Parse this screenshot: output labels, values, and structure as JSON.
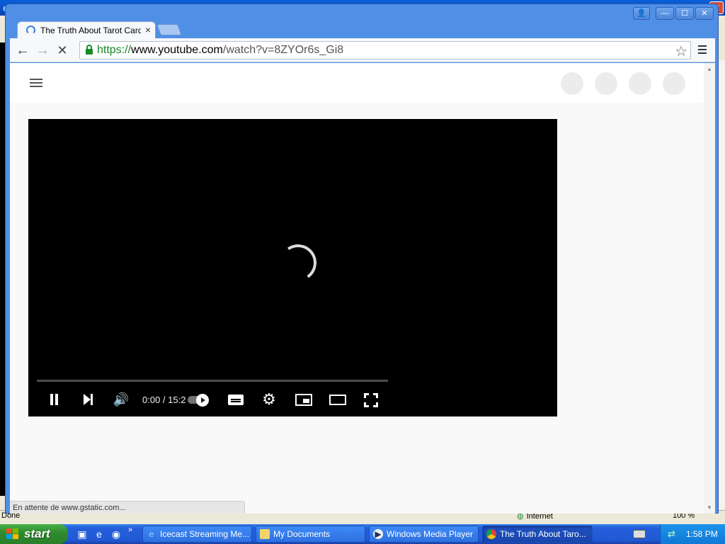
{
  "background_window": {
    "status_left": "Done",
    "status_zone": "Internet",
    "status_zoom": "100 %",
    "close_glyph": "✕"
  },
  "chrome": {
    "caption_user": "👤",
    "caption_min": "—",
    "caption_max": "☐",
    "caption_close": "✕",
    "tab": {
      "title": "The Truth About Tarot Cards",
      "close": "×"
    },
    "nav": {
      "back": "←",
      "forward": "→",
      "stop": "✕"
    },
    "address": {
      "scheme": "https://",
      "host": "www.youtube.com",
      "path": "/watch?v=8ZYOr6s_Gi8"
    },
    "bookmark_star": "☆"
  },
  "page": {
    "player": {
      "time": "0:00 / 15:2",
      "volume_glyph": "🔊",
      "settings_glyph": "⚙"
    },
    "status_bubble": "En attente de www.gstatic.com..."
  },
  "taskbar": {
    "start_label": "start",
    "more": "»",
    "tasks": [
      {
        "label": "Icecast Streaming Me...",
        "icon": "ie-icon"
      },
      {
        "label": "My Documents",
        "icon": "folder-icon"
      },
      {
        "label": "Windows Media Player",
        "icon": "media-player-icon"
      },
      {
        "label": "The Truth About Taro...",
        "icon": "chrome-icon"
      }
    ],
    "clock": "1:58 PM"
  },
  "colors": {
    "xp_blue": "#245edb",
    "start_green": "#2f8d2f",
    "https_green": "#178a28",
    "player_bg": "#000000"
  }
}
